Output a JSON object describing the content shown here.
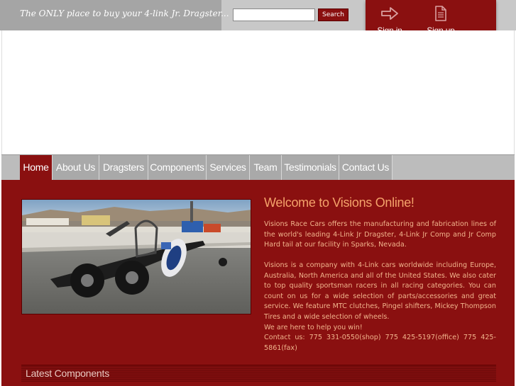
{
  "header": {
    "tagline": "The ONLY place to buy your 4-link Jr. Dragster...",
    "search": {
      "value": "",
      "placeholder": "",
      "button_label": "Search"
    },
    "account": {
      "signin_label": "Sign in",
      "signin_icon": "arrow-right-icon",
      "signup_label": "Sign up",
      "signup_icon": "document-icon"
    }
  },
  "nav": {
    "items": [
      {
        "label": "Home",
        "active": true
      },
      {
        "label": "About Us"
      },
      {
        "label": "Dragsters"
      },
      {
        "label": "Components"
      },
      {
        "label": "Services"
      },
      {
        "label": "Team"
      },
      {
        "label": "Testimonials"
      },
      {
        "label": "Contact Us"
      }
    ]
  },
  "main": {
    "welcome_title": "Welcome to Visions Online!",
    "paragraph1": "Visions Race Cars offers the manufacturing and fabrication lines of the world's leading 4-Link Jr Dragster, 4-Link Jr Comp and Jr Comp Hard tail at our facility in Sparks, Nevada.",
    "paragraph2": "Visions is a company with 4-Link cars worldwide including Europe, Australia, North America and all of the United States. We also cater to top quality sportsman racers in all racing categories. You can count on us for a wide selection of parts/accessories and great service. We feature MTC clutches, Pingel shifters, Mickey Thompson Tires and a wide selection of wheels.",
    "paragraph3": "We are here to help you win!",
    "contact": "Contact us: 775 331-0550(shop) 775 425-5197(office) 775 425-5861(fax)",
    "photo_alt_icon": "dragster-photo",
    "latest_title": "Latest Components"
  },
  "colors": {
    "brand_red": "#8a1010",
    "nav_gray": "#a9a9a9",
    "text_orange": "#f1b48c",
    "title_orange": "#f4a26a"
  }
}
